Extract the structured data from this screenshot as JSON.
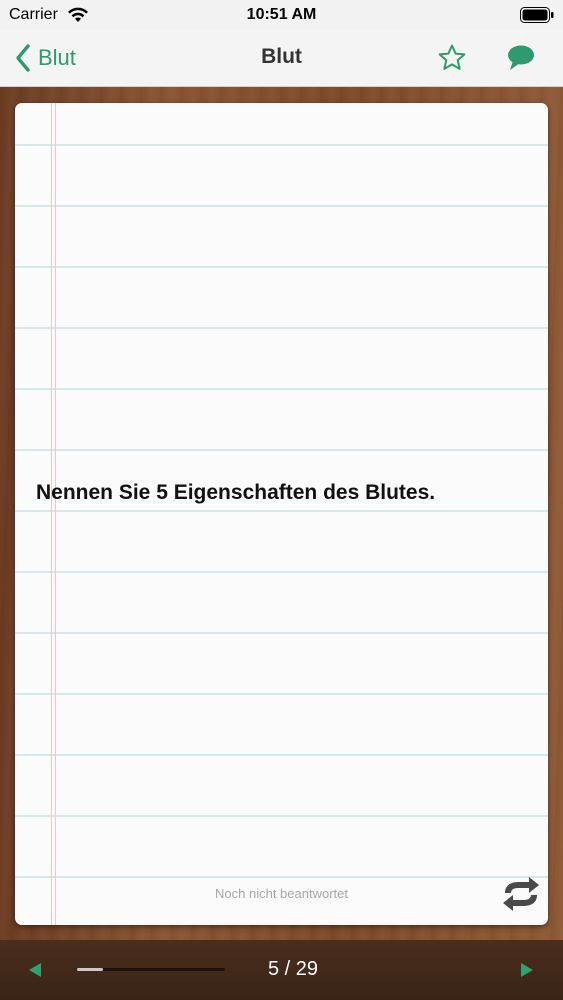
{
  "status_bar": {
    "carrier": "Carrier",
    "time": "10:51 AM"
  },
  "nav": {
    "back_label": "Blut",
    "title": "Blut",
    "accent_color": "#2d9b6d"
  },
  "card": {
    "question": "Nennen Sie 5 Eigenschaften des Blutes.",
    "status": "Noch nicht beantwortet"
  },
  "footer": {
    "page_indicator": "5 / 29",
    "current": 5,
    "total": 29
  },
  "icons": {
    "back": "chevron-left-icon",
    "favorite": "star-icon",
    "comment": "speech-bubble-icon",
    "flip": "flip-arrows-icon",
    "previous": "triangle-left-icon",
    "next": "triangle-right-icon"
  }
}
